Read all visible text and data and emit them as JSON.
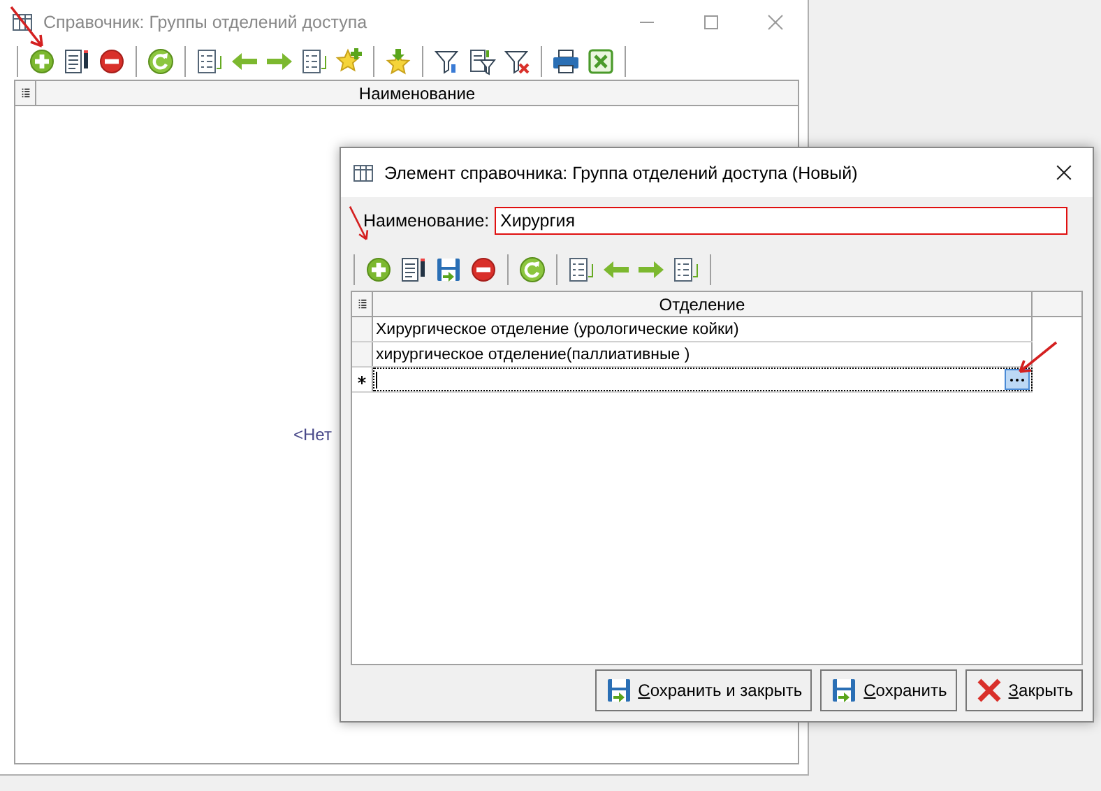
{
  "main_window": {
    "title": "Справочник: Группы отделений доступа",
    "active": false,
    "columns": [
      "Наименование"
    ],
    "empty_text": "<Нет"
  },
  "dialog": {
    "title": "Элемент справочника: Группа отделений доступа (Новый)",
    "active": true,
    "name_label": "Наименование:",
    "name_value": "Хирургия",
    "name_invalid": true,
    "columns": [
      "Отделение"
    ],
    "rows": [
      {
        "kind": "data",
        "cells": [
          "Хирургическое отделение (урологические койки)"
        ]
      },
      {
        "kind": "data",
        "cells": [
          "хирургическое отделение(паллиативные )"
        ]
      },
      {
        "kind": "new",
        "editing": true
      }
    ],
    "buttons": [
      {
        "kind": "save",
        "label": "Сохранить и закрыть",
        "mnemonic_underlined": true
      },
      {
        "kind": "save",
        "label": "Сохранить",
        "mnemonic_underlined": true
      },
      {
        "kind": "close",
        "label": "Закрыть",
        "mnemonic_underlined": true
      }
    ]
  }
}
